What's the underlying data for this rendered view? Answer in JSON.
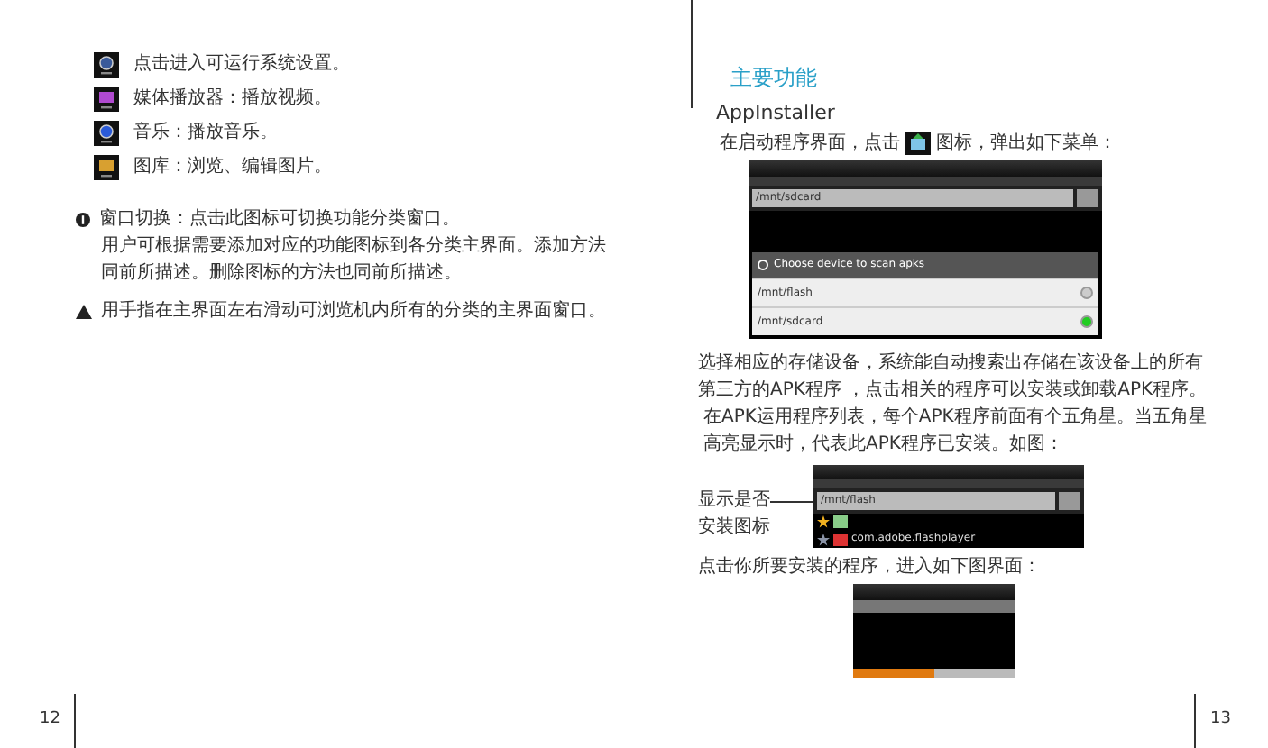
{
  "left_page": {
    "items": [
      {
        "kind": "settings",
        "text": "点击进入可运行系统设置。"
      },
      {
        "kind": "media",
        "text": "媒体播放器：播放视频。"
      },
      {
        "kind": "music",
        "text": "音乐：播放音乐。"
      },
      {
        "kind": "gallery",
        "text": "图库：浏览、编辑图片。"
      }
    ],
    "note": {
      "text": "窗口切换：点击此图标可切换功能分类窗口。",
      "lines": [
        "用户可根据需要添加对应的功能图标到各分类主界面。添加方法",
        "同前所描述。删除图标的方法也同前所描述。"
      ]
    },
    "tip": "用手指在主界面左右滑动可浏览机内所有的分类的主界面窗口。",
    "page_number": "12"
  },
  "right_page": {
    "section_title": "主要功能",
    "app_name": "AppInstaller",
    "intro_before": "在启动程序界面，点击",
    "intro_after": "图标，弹出如下菜单：",
    "screenshot_1": {
      "path": "/mnt/sdcard",
      "dialog_title": "Choose device to scan apks",
      "options": [
        {
          "label": "/mnt/flash",
          "selected": false
        },
        {
          "label": "/mnt/sdcard",
          "selected": true
        }
      ]
    },
    "paragraphs": [
      "选择相应的存储设备，系统能自动搜索出存储在该设备上的所有",
      "第三方的APK程序 ，点击相关的程序可以安装或卸载APK程序。",
      "在APK运用程序列表，每个APK程序前面有个五角星。当五角星",
      "高亮显示时，代表此APK程序已安装。如图："
    ],
    "callout": [
      "显示是否",
      "安装图标"
    ],
    "screenshot_2": {
      "path": "/mnt/flash",
      "rows": [
        {
          "installed": true
        },
        {
          "title": "com.adobe.flashplayer",
          "installed": false
        }
      ]
    },
    "outro": "点击你所要安装的程序，进入如下图界面：",
    "page_number": "13"
  }
}
